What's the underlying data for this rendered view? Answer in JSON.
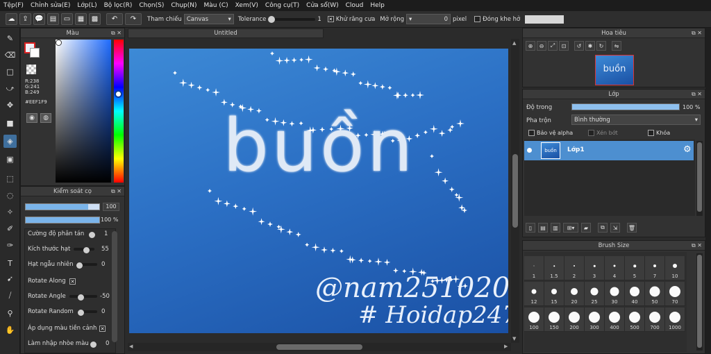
{
  "menu": [
    "Tệp(F)",
    "Chỉnh sửa(E)",
    "Lớp(L)",
    "Bộ lọc(R)",
    "Chọn(S)",
    "Chụp(N)",
    "Màu (C)",
    "Xem(V)",
    "Công cụ(T)",
    "Cửa sổ(W)",
    "Cloud",
    "Help"
  ],
  "toolbar": {
    "ref_label": "Tham chiếu",
    "ref_value": "Canvas",
    "tolerance_label": "Tolerance",
    "tolerance_value": "1",
    "antialias_label": "Khử răng cưa",
    "expand_label": "Mở rộng",
    "expand_value": "0",
    "expand_unit": "pixel",
    "close_gap_label": "Đóng khe hở"
  },
  "color_panel": {
    "title": "Màu",
    "r": "R:238",
    "g": "G:241",
    "b": "B:249",
    "hex": "#EEF1F9",
    "current_color": "#EEF1F9"
  },
  "brush_panel": {
    "title": "Kiểm soát cọ",
    "size_value": "100",
    "opacity_value": "100 %",
    "settings": [
      {
        "name": "Cường độ phân tán",
        "value": "1"
      },
      {
        "name": "Kích thước hạt",
        "value": "55"
      },
      {
        "name": "Hạt ngẫu nhiên",
        "value": "0"
      },
      {
        "name": "Rotate Along",
        "value": ""
      },
      {
        "name": "Rotate Angle",
        "value": "-50"
      },
      {
        "name": "Rotate Random",
        "value": "0"
      },
      {
        "name": "Áp dụng màu tiền cảnh",
        "value": ""
      },
      {
        "name": "Làm nhập nhòe màu",
        "value": "0"
      }
    ]
  },
  "document": {
    "tab_title": "Untitled",
    "art_word": "buồn",
    "art_signature_line1": "@nam251020",
    "art_signature_line2": "# Hoidap247"
  },
  "navigator": {
    "title": "Hoa tiêu"
  },
  "layers": {
    "title": "Lớp",
    "opacity_label": "Độ trong",
    "opacity_value": "100 %",
    "opacity_fraction": 1.0,
    "blend_label": "Pha trộn",
    "blend_value": "Bình thường",
    "protect_alpha": "Bảo vệ alpha",
    "clipping": "Xén bớt",
    "lock": "Khóa",
    "layer_name": "Lớp1"
  },
  "brush_size": {
    "title": "Brush Size",
    "sizes": [
      "1",
      "1.5",
      "2",
      "3",
      "4",
      "5",
      "7",
      "10",
      "12",
      "15",
      "20",
      "25",
      "30",
      "40",
      "50",
      "70",
      "100",
      "150",
      "200",
      "300",
      "400",
      "500",
      "700",
      "1000"
    ]
  },
  "colors": {
    "accent": "#3f7fc0",
    "canvas_top": "#3a86d4",
    "canvas_bottom": "#1c55a8",
    "layer_row": "#4d8fd0"
  }
}
